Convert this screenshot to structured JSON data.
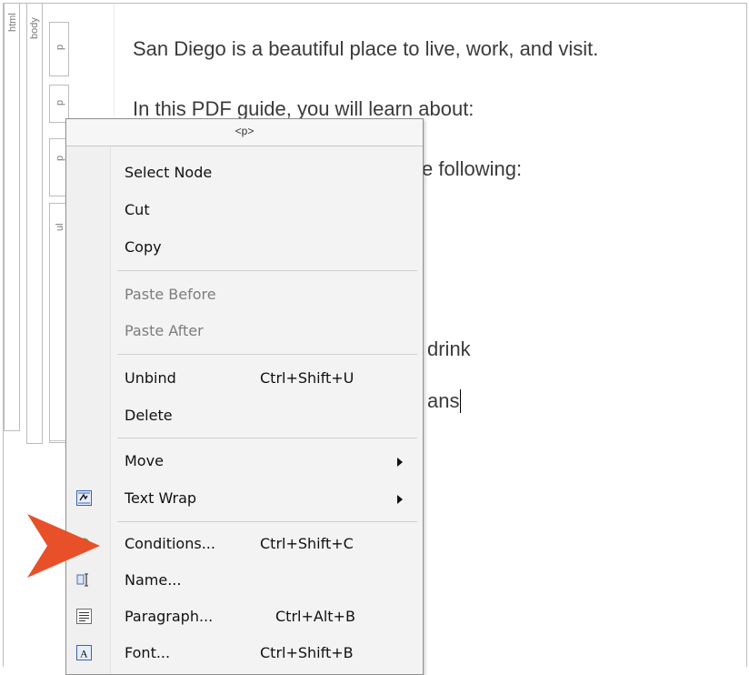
{
  "structure_bars": {
    "html": "html",
    "body": "body",
    "p1": "p",
    "p2": "p",
    "p3": "p",
    "ul": "ul"
  },
  "document": {
    "line1": "San Diego is a beautiful place to live, work, and visit.",
    "line2": "In this PDF guide, you will learn about:",
    "line3": "e following:",
    "line4": "drink",
    "line5": "ans"
  },
  "context_menu": {
    "header": "<p>",
    "items": [
      {
        "label": "Select Node",
        "shortcut": "",
        "enabled": true
      },
      {
        "label": "Cut",
        "shortcut": "",
        "enabled": true
      },
      {
        "label": "Copy",
        "shortcut": "",
        "enabled": true
      },
      {
        "label": "Paste Before",
        "shortcut": "",
        "enabled": false
      },
      {
        "label": "Paste After",
        "shortcut": "",
        "enabled": false
      },
      {
        "label": "Unbind",
        "shortcut": "Ctrl+Shift+U",
        "enabled": true
      },
      {
        "label": "Delete",
        "shortcut": "",
        "enabled": true
      },
      {
        "label": "Move",
        "shortcut": "",
        "enabled": true,
        "submenu": true
      },
      {
        "label": "Text Wrap",
        "shortcut": "",
        "enabled": true,
        "submenu": true,
        "icon": "text-wrap-icon"
      },
      {
        "label": "Conditions...",
        "shortcut": "Ctrl+Shift+C",
        "enabled": true,
        "icon": "conditions-icon"
      },
      {
        "label": "Name...",
        "shortcut": "",
        "enabled": true,
        "icon": "name-icon"
      },
      {
        "label": "Paragraph...",
        "shortcut": "Ctrl+Alt+B",
        "enabled": true,
        "icon": "paragraph-icon"
      },
      {
        "label": "Font...",
        "shortcut": "Ctrl+Shift+B",
        "enabled": true,
        "icon": "font-icon"
      }
    ]
  },
  "colors": {
    "pointer_arrow": "#e8502a",
    "menu_background": "#f3f3f3",
    "disabled_text": "#7d7d7d"
  }
}
